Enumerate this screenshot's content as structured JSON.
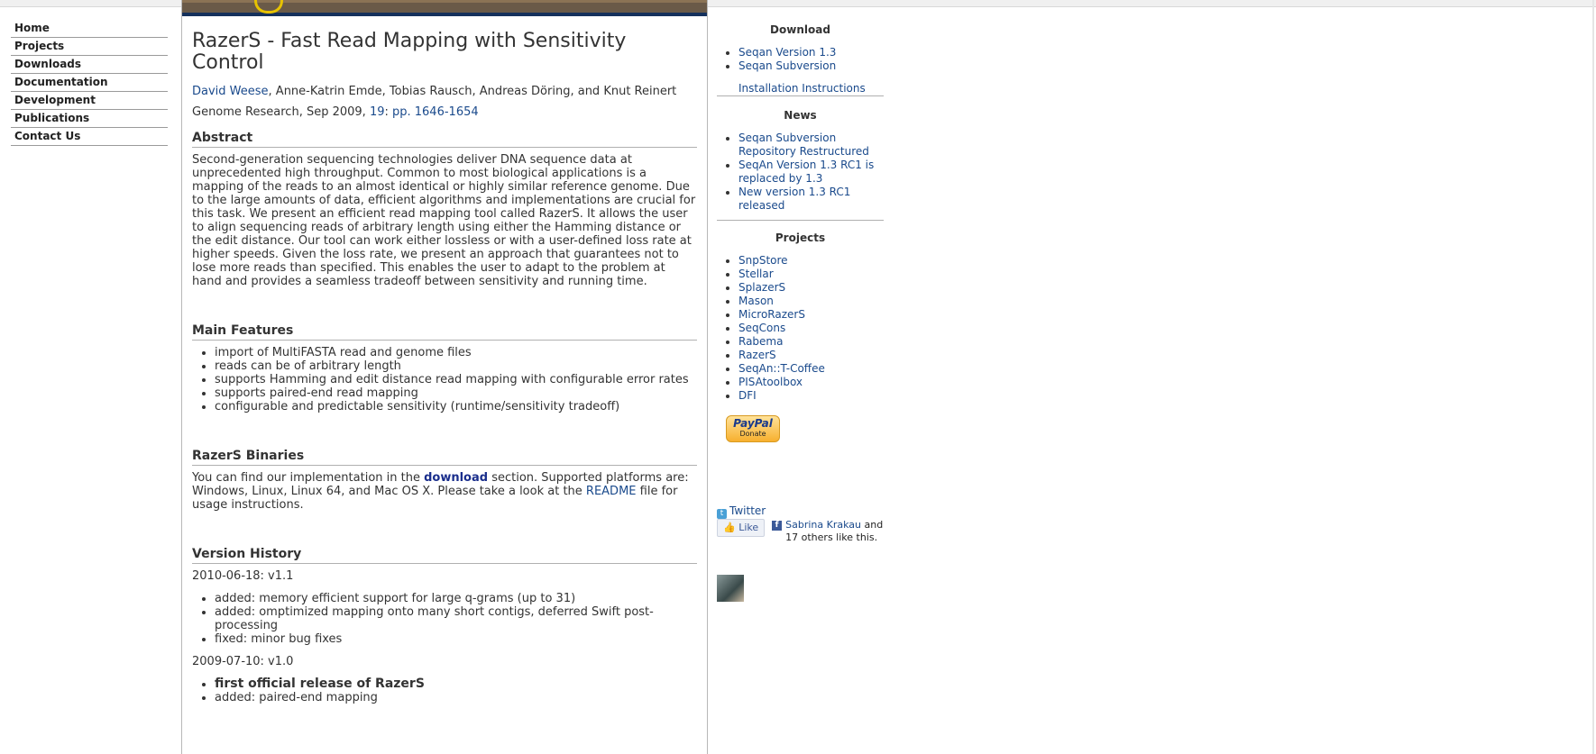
{
  "nav": [
    "Home",
    "Projects",
    "Downloads",
    "Documentation",
    "Development",
    "Publications",
    "Contact Us"
  ],
  "title": "RazerS - Fast Read Mapping with Sensitivity Control",
  "authors": {
    "link": "David Weese",
    "rest": ", Anne-Katrin Emde, Tobias Rausch, Andreas Döring, and Knut Reinert"
  },
  "citation": {
    "journal": "Genome Research, Sep 2009, ",
    "volume": "19",
    "sep": ": ",
    "pages": "pp. 1646-1654"
  },
  "abstract": {
    "heading": "Abstract",
    "text": "Second-generation sequencing technologies deliver DNA sequence data at unprecedented high throughput. Common to most biological applications is a mapping of the reads to an almost identical or highly similar reference genome. Due to the large amounts of data, efficient algorithms and implementations are crucial for this task. We present an efficient read mapping tool called RazerS. It allows the user to align sequencing reads of arbitrary length using either the Hamming distance or the edit distance. Our tool can work either lossless or with a user-defined loss rate at higher speeds. Given the loss rate, we present an approach that guarantees not to lose more reads than specified. This enables the user to adapt to the problem at hand and provides a seamless tradeoff between sensitivity and running time."
  },
  "features": {
    "heading": "Main Features",
    "items": [
      "import of MultiFASTA read and genome files",
      "reads can be of arbitrary length",
      "supports Hamming and edit distance read mapping with configurable error rates",
      "supports paired-end read mapping",
      "configurable and predictable sensitivity (runtime/sensitivity tradeoff)"
    ]
  },
  "binaries": {
    "heading": "RazerS Binaries",
    "t1": "You can find our implementation in the ",
    "download": "download",
    "t2": " section. Supported platforms are: Windows, Linux, Linux 64, and Mac OS X. Please take a look at the ",
    "readme": "README",
    "t3": " file for usage instructions."
  },
  "history": {
    "heading": "Version History",
    "v1_date": "2010-06-18: v1.1",
    "v1_items": [
      "added: memory efficient support for large q-grams (up to 31)",
      "added: omptimized mapping onto many short contigs, deferred Swift post-processing",
      "fixed: minor bug fixes"
    ],
    "v0_date": "2009-07-10: v1.0",
    "v0_item1": "first official release of RazerS",
    "v0_item2": "added: paired-end mapping"
  },
  "sidebar": {
    "download_heading": "Download",
    "download_items": [
      "Seqan Version 1.3",
      "Seqan Subversion"
    ],
    "install": "Installation Instructions",
    "news_heading": "News",
    "news_items": [
      "Seqan Subversion Repository Restructured",
      "SeqAn Version 1.3 RC1 is replaced by 1.3",
      "New version 1.3 RC1 released"
    ],
    "projects_heading": "Projects",
    "projects_items": [
      "SnpStore",
      "Stellar",
      "SplazerS",
      "Mason",
      "MicroRazerS",
      "SeqCons",
      "Rabema",
      "RazerS",
      "SeqAn::T-Coffee",
      "PISAtoolbox",
      "DFI"
    ],
    "paypal_brand": "PayPal",
    "paypal_label": "Donate",
    "twitter": "Twitter",
    "like": "Like",
    "fb_name": "Sabrina Krakau",
    "fb_and": " and",
    "fb_rest": "17 others like this."
  }
}
